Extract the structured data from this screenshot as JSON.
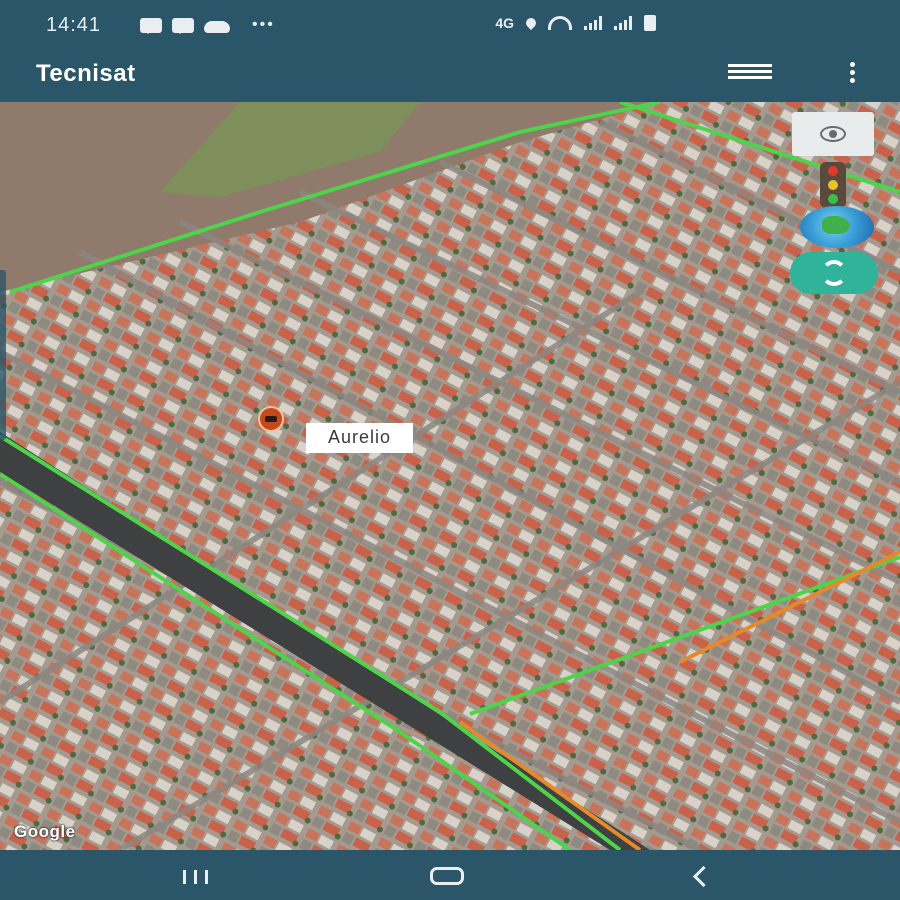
{
  "status_bar": {
    "time": "14:41",
    "left_icons": [
      "message-icon",
      "message-icon",
      "cloud-icon",
      "more-dots-icon"
    ],
    "network_label": "4G",
    "right_icons": [
      "location-icon",
      "wifi-icon",
      "signal-icon",
      "signal-icon",
      "battery-icon"
    ]
  },
  "app_bar": {
    "title": "Tecnisat",
    "icons": [
      "list-icon",
      "more-vert-icon"
    ]
  },
  "map": {
    "type": "satellite",
    "vehicle_label": "Aurelio",
    "provider_logo": "Google",
    "tools": [
      "eye-icon",
      "traffic-light-icon",
      "globe-icon",
      "refresh-icon"
    ],
    "route_colors": {
      "green": "#4fd34a",
      "orange": "#e58a2a"
    }
  },
  "nav_bar": {
    "buttons": [
      "recents-icon",
      "home-icon",
      "back-icon"
    ]
  },
  "colors": {
    "primary": "#2b5568",
    "refresh_button": "#2fb39a",
    "marker": "#c44a1d"
  }
}
